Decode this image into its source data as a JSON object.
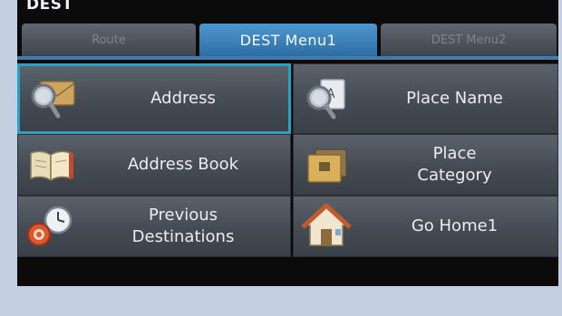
{
  "screen": {
    "title": "DEST"
  },
  "tabs": [
    {
      "label": "Route"
    },
    {
      "label": "DEST Menu1"
    },
    {
      "label": "DEST Menu2"
    }
  ],
  "menu": {
    "items": [
      {
        "label": "Address",
        "icon": "address-search-icon"
      },
      {
        "label": "Place Name",
        "icon": "place-name-search-icon"
      },
      {
        "label": "Address Book",
        "icon": "address-book-icon"
      },
      {
        "label": "Place\nCategory",
        "icon": "place-category-icon"
      },
      {
        "label": "Previous\nDestinations",
        "icon": "previous-destinations-icon"
      },
      {
        "label": "Go Home1",
        "icon": "home-icon"
      }
    ]
  },
  "colors": {
    "active_tab": "#3f86c0",
    "selection_outline": "#20a4c8",
    "button_face": "#4c535c",
    "background": "#c4cfe2"
  }
}
